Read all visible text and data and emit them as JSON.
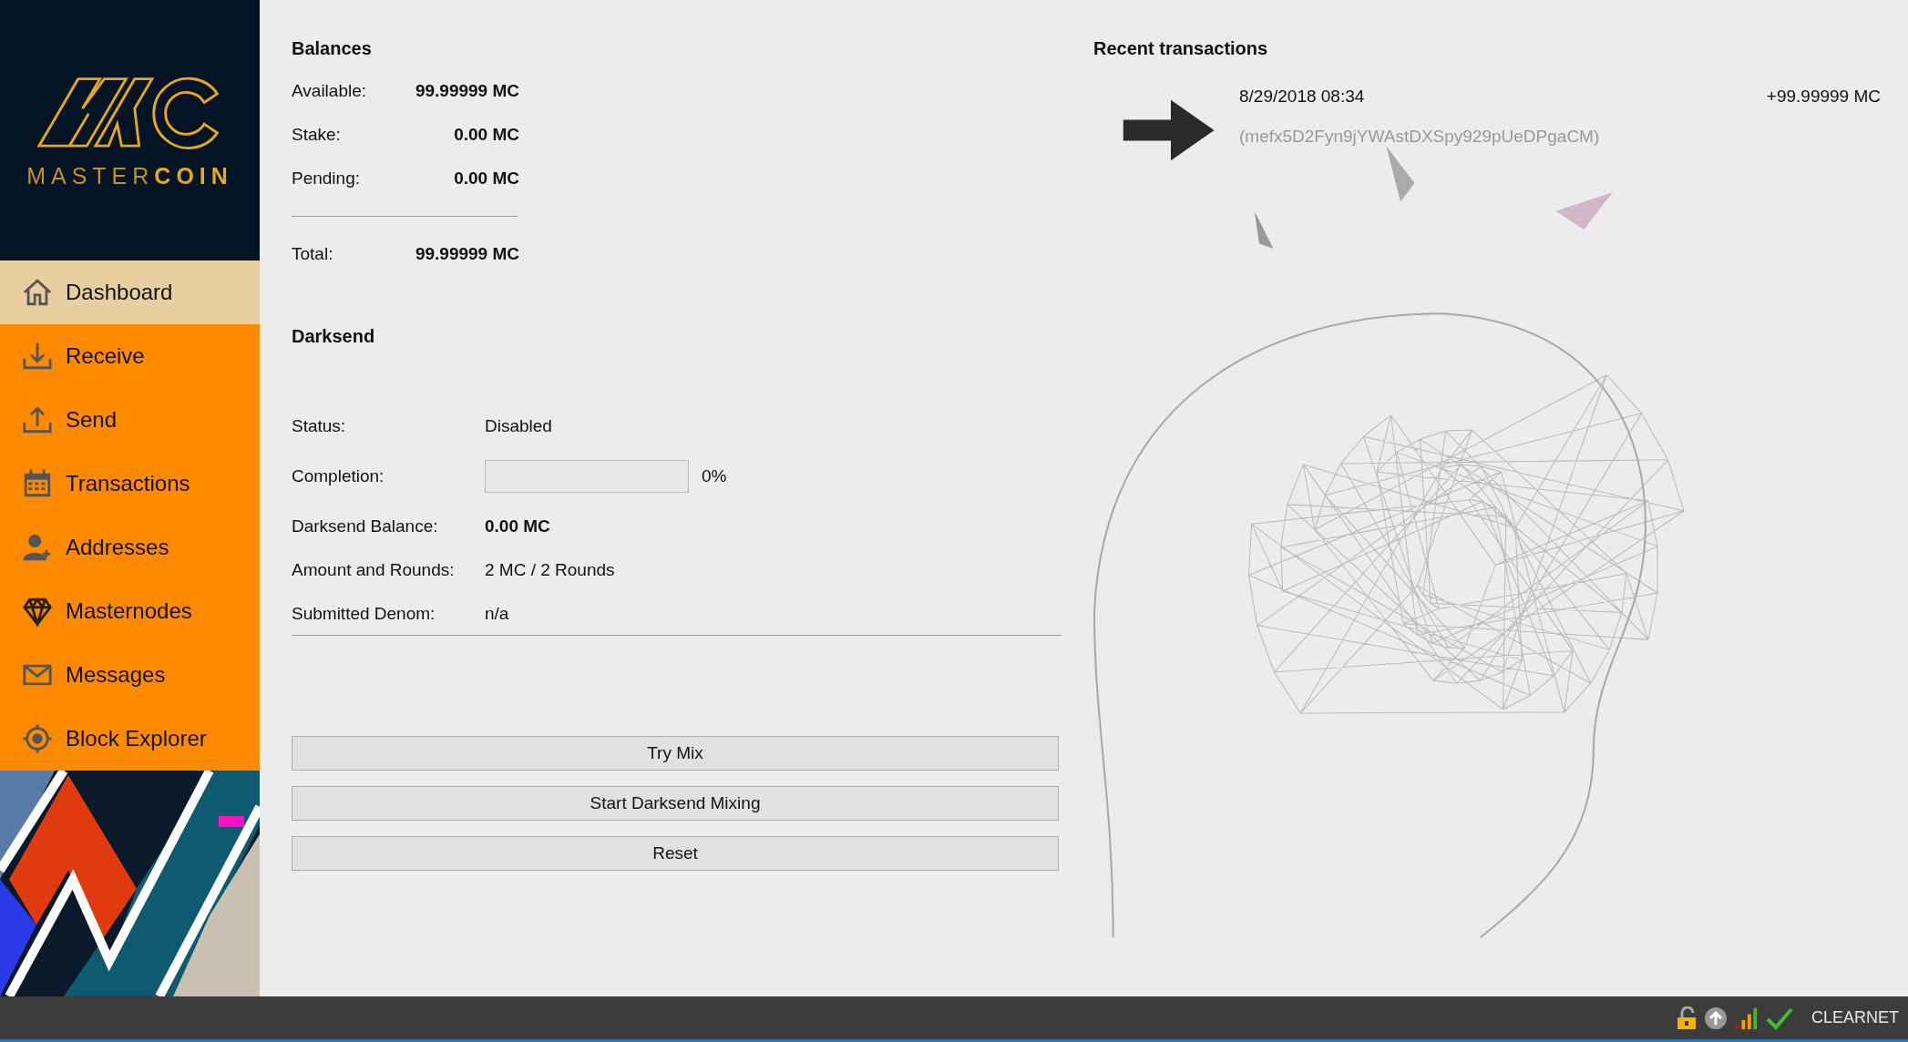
{
  "logo": {
    "name_light": "MASTER",
    "name_bold": "COIN"
  },
  "sidebar": {
    "items": [
      {
        "label": "Dashboard",
        "selected": true
      },
      {
        "label": "Receive",
        "selected": false
      },
      {
        "label": "Send",
        "selected": false
      },
      {
        "label": "Transactions",
        "selected": false
      },
      {
        "label": "Addresses",
        "selected": false
      },
      {
        "label": "Masternodes",
        "selected": false
      },
      {
        "label": "Messages",
        "selected": false
      },
      {
        "label": "Block Explorer",
        "selected": false
      }
    ]
  },
  "balances": {
    "title": "Balances",
    "rows": [
      {
        "label": "Available:",
        "value": "99.99999 MC"
      },
      {
        "label": "Stake:",
        "value": "0.00 MC"
      },
      {
        "label": "Pending:",
        "value": "0.00 MC"
      }
    ],
    "total": {
      "label": "Total:",
      "value": "99.99999 MC"
    }
  },
  "darksend": {
    "title": "Darksend",
    "rows": [
      {
        "kind": "text",
        "label": "Status:",
        "value": "Disabled"
      },
      {
        "kind": "progress",
        "label": "Completion:",
        "level": 0,
        "value": "0%"
      },
      {
        "kind": "bold",
        "label": "Darksend Balance:",
        "value": "0.00 MC"
      },
      {
        "kind": "text",
        "label": "Amount and Rounds:",
        "value": "2 MC / 2 Rounds"
      },
      {
        "kind": "text",
        "label": "Submitted Denom:",
        "value": "n/a"
      }
    ],
    "buttons": [
      "Try Mix",
      "Start Darksend Mixing",
      "Reset"
    ]
  },
  "recent_transactions": {
    "title": "Recent transactions",
    "items": [
      {
        "date": "8/29/2018 08:34",
        "amount": "+99.99999 MC",
        "address": "(mefx5D2Fyn9jYWAstDXSpy929pUeDPgaCM)"
      }
    ]
  },
  "status_bar": {
    "network": "CLEARNET"
  }
}
